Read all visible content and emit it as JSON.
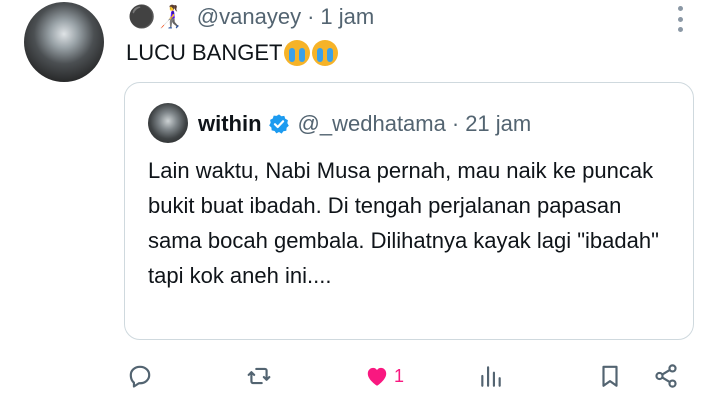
{
  "tweet": {
    "user_emojis": "⚫️👩‍🦯",
    "handle": "@vanayey",
    "time": "1 jam",
    "text": "LUCU BANGET",
    "text_emoji": "loudly-crying-face"
  },
  "quoted": {
    "name": "within",
    "handle": "@_wedhatama",
    "time": "21 jam",
    "verified": true,
    "body": "Lain waktu, Nabi Musa pernah, mau naik ke puncak bukit buat ibadah. Di tengah perjalanan papasan sama bocah gembala. Dilihatnya kayak lagi \"ibadah\" tapi kok aneh ini...."
  },
  "actions": {
    "like_count": "1"
  },
  "colors": {
    "like": "#f91880",
    "icon": "#536471",
    "verified": "#1d9bf0"
  }
}
